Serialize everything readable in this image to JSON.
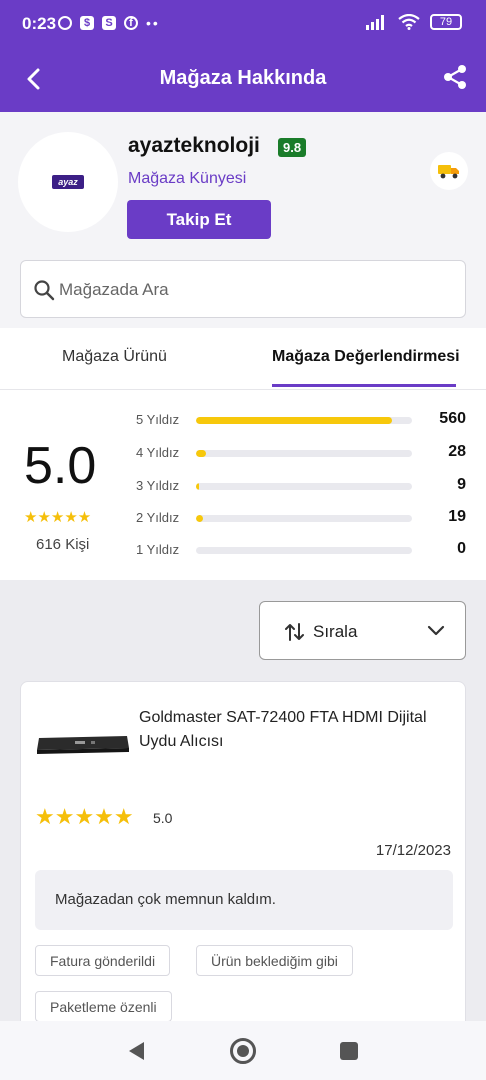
{
  "status_bar": {
    "time": "0:23",
    "battery": "79"
  },
  "app_bar": {
    "title": "Mağaza Hakkında"
  },
  "store": {
    "name": "ayazteknoloji",
    "score": "9.8",
    "logo_text": "ayaz",
    "kunye": "Mağaza Künyesi",
    "follow_label": "Takip Et"
  },
  "search": {
    "placeholder": "Mağazada Ara"
  },
  "tabs": [
    {
      "label": "Mağaza Ürünü",
      "active": false
    },
    {
      "label": "Mağaza Değerlendirmesi",
      "active": true
    }
  ],
  "rating": {
    "average": "5.0",
    "stars": "★★★★★",
    "people": "616 Kişi",
    "rows": [
      {
        "label": "5 Yıldız",
        "count": "560",
        "fraction": 0.909
      },
      {
        "label": "4 Yıldız",
        "count": "28",
        "fraction": 0.045
      },
      {
        "label": "3 Yıldız",
        "count": "9",
        "fraction": 0.015
      },
      {
        "label": "2 Yıldız",
        "count": "19",
        "fraction": 0.031
      },
      {
        "label": "1 Yıldız",
        "count": "0",
        "fraction": 0
      }
    ]
  },
  "sort": {
    "label": "Sırala"
  },
  "review": {
    "product_title": "Goldmaster SAT-72400 FTA HDMI Dijital Uydu Alıcısı",
    "stars": "★★★★★",
    "score": "5.0",
    "date": "17/12/2023",
    "comment": "Mağazadan çok memnun kaldım.",
    "tags": [
      "Fatura gönderildi",
      "Ürün beklediğim gibi",
      "Paketleme özenli"
    ]
  },
  "colors": {
    "primary": "#6a3cc6",
    "star": "#f5bf0a",
    "badge": "#1a7c2a"
  }
}
